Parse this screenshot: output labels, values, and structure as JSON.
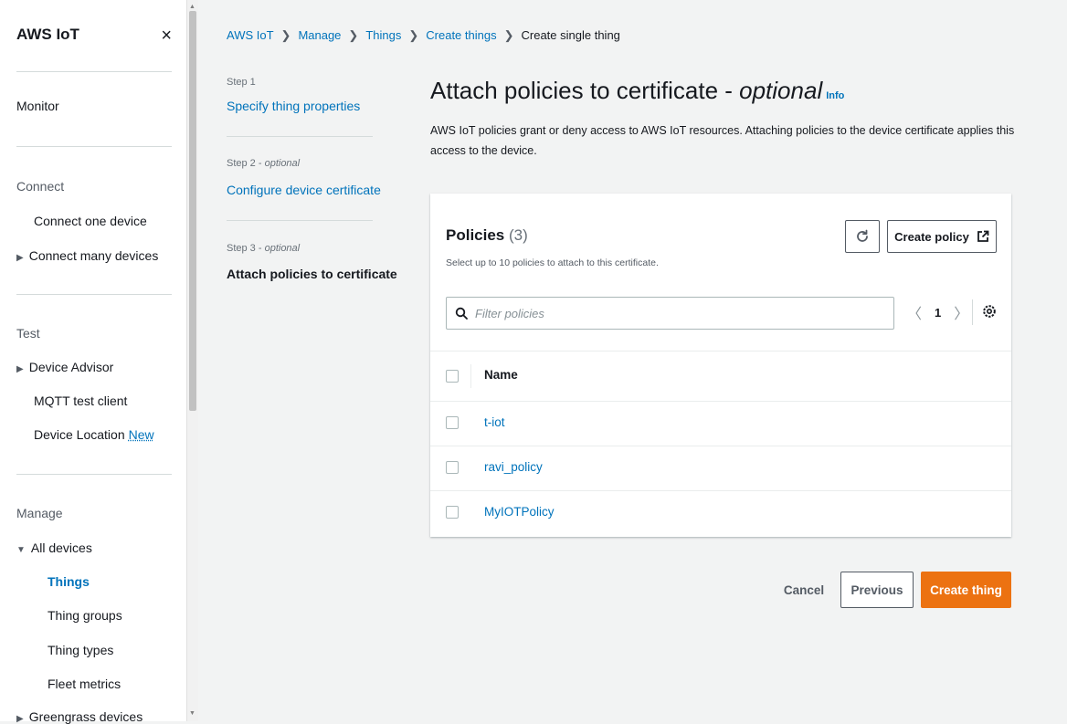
{
  "colors": {
    "accent": "#0073bb",
    "primary_button": "#ec7211",
    "background": "#f2f3f3"
  },
  "sidebar": {
    "title": "AWS IoT",
    "close_icon": "×",
    "monitor": "Monitor",
    "connect": {
      "heading": "Connect",
      "items": [
        "Connect one device",
        "Connect many devices"
      ]
    },
    "test": {
      "heading": "Test",
      "items": [
        "Device Advisor",
        "MQTT test client",
        "Device Location"
      ],
      "new_badge": "New"
    },
    "manage": {
      "heading": "Manage",
      "all_devices": "All devices",
      "items": [
        "Things",
        "Thing groups",
        "Thing types",
        "Fleet metrics"
      ],
      "active": "Things",
      "greengrass": "Greengrass devices"
    }
  },
  "breadcrumb": [
    "AWS IoT",
    "Manage",
    "Things",
    "Create things",
    "Create single thing"
  ],
  "steps": [
    {
      "label": "Step 1",
      "optional": "",
      "title": "Specify thing properties"
    },
    {
      "label": "Step 2 - ",
      "optional": "optional",
      "title": "Configure device certificate"
    },
    {
      "label": "Step 3 - ",
      "optional": "optional",
      "title": "Attach policies to certificate"
    }
  ],
  "page": {
    "title": "Attach policies to certificate - ",
    "title_optional": "optional",
    "info": "Info",
    "description": "AWS IoT policies grant or deny access to AWS IoT resources. Attaching policies to the device certificate applies this access to the device."
  },
  "policies": {
    "title": "Policies",
    "count": "(3)",
    "subtitle": "Select up to 10 policies to attach to this certificate.",
    "create_label": "Create policy",
    "filter_placeholder": "Filter policies",
    "page": "1",
    "column_name": "Name",
    "rows": [
      "t-iot",
      "ravi_policy",
      "MyIOTPolicy"
    ]
  },
  "footer": {
    "cancel": "Cancel",
    "previous": "Previous",
    "create": "Create thing"
  }
}
